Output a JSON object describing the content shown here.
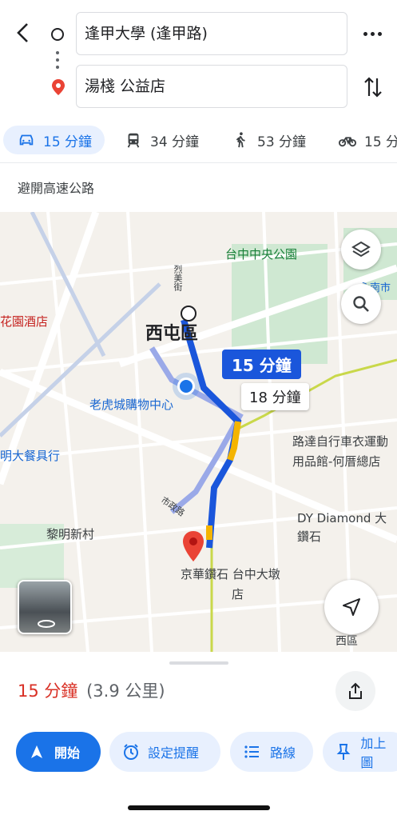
{
  "search": {
    "origin": "逢甲大學 (逢甲路)",
    "destination": "湯棧 公益店"
  },
  "modes": [
    {
      "icon": "car-icon",
      "label": "15 分鐘",
      "active": true
    },
    {
      "icon": "transit-icon",
      "label": "34 分鐘"
    },
    {
      "icon": "walk-icon",
      "label": "53 分鐘"
    },
    {
      "icon": "bike-icon",
      "label": "15 分"
    }
  ],
  "options": {
    "avoid_highways": "避開高速公路"
  },
  "map": {
    "labels": {
      "park": "台中中央公園",
      "district": "西屯區",
      "mall": "老虎城購物中心",
      "hotel": "花園酒店",
      "restaurant": "明大餐具行",
      "village": "黎明新村",
      "bike_shop_1": "路達自行車衣運動",
      "bike_shop_2": "用品館-何厝總店",
      "dy_1": "DY Diamond 大",
      "dy_2": "鑽石",
      "dest_1": "京華鑽石 台中大墩",
      "dest_2": "店",
      "street_1": "烈美街",
      "street_2": "市政路",
      "corner_right": "永南市",
      "corner_bottom": "西區"
    },
    "route_primary": "15 分鐘",
    "route_alt": "18 分鐘",
    "colors": {
      "route": "#1a56db",
      "alt": "#9aa9e8",
      "slow": "#f4b400"
    }
  },
  "sheet": {
    "duration": "15 分鐘",
    "distance": "(3.9 公里)",
    "buttons": {
      "start": "開始",
      "reminder": "設定提醒",
      "steps": "路線",
      "pin": "加上圖"
    }
  }
}
